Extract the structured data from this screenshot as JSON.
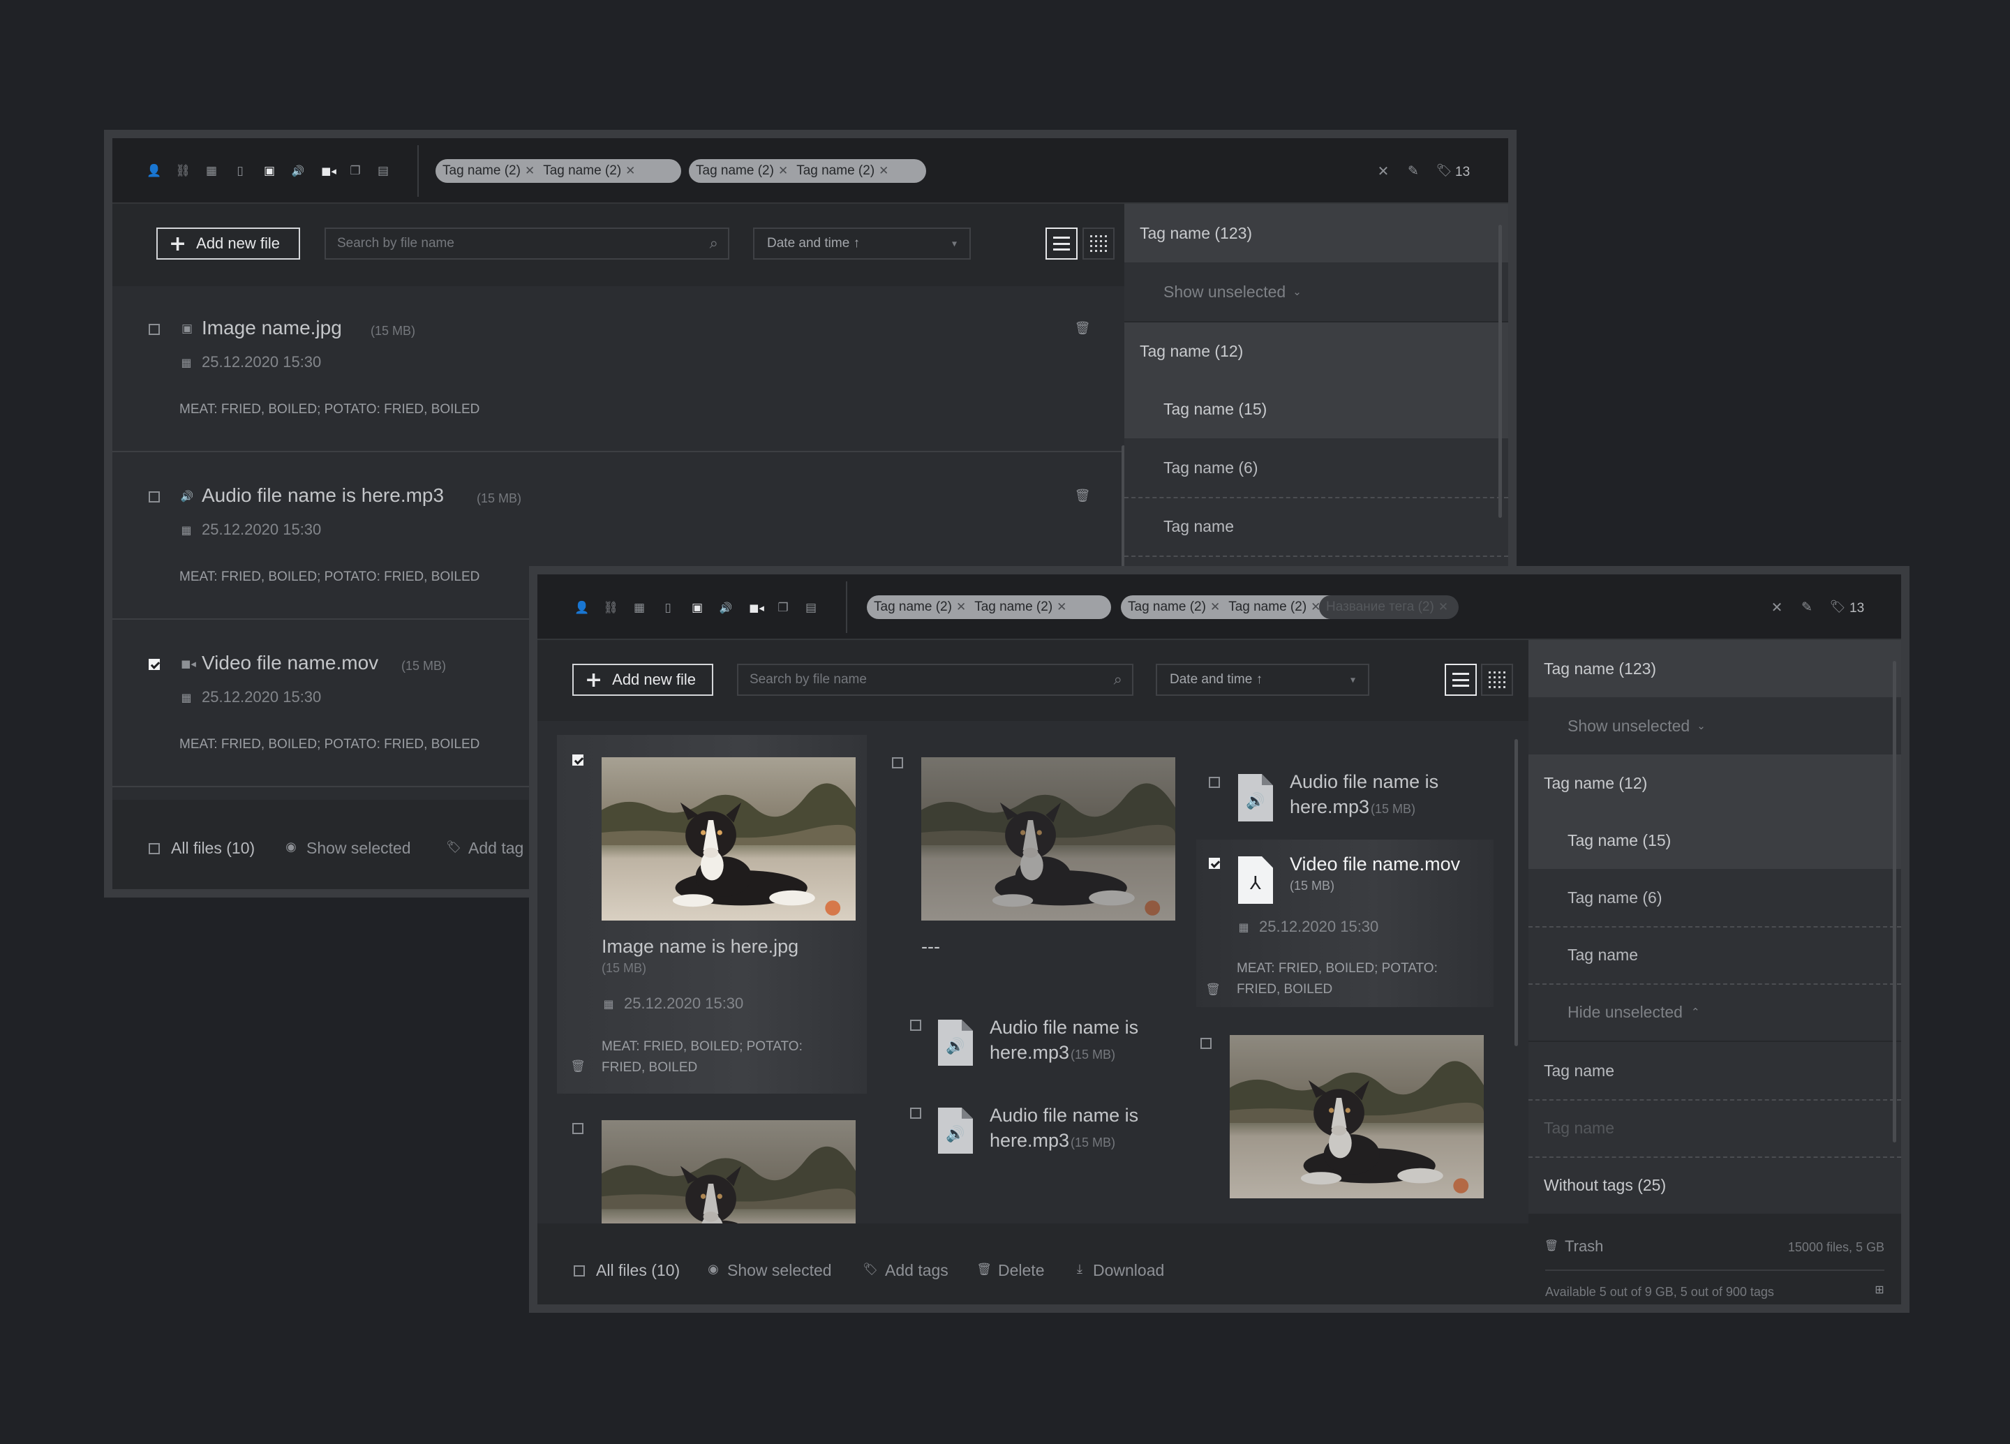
{
  "back_window": {
    "toolbar": {
      "tags_group1": [
        "Tag name (2)",
        "Tag name (2)"
      ],
      "tags_group2": [
        "Tag name (2)",
        "Tag name (2)"
      ],
      "tag_count": "13"
    },
    "actions": {
      "add_label": "Add new file",
      "search_placeholder": "Search by file name",
      "sort_label": "Date and time ↑"
    },
    "files": [
      {
        "name": "Image name.jpg",
        "size": "(15 MB)",
        "date": "25.12.2020 15:30",
        "tags": "MEAT: FRIED, BOILED; POTATO: FRIED, BOILED",
        "checked": false
      },
      {
        "name": "Audio file name is here.mp3",
        "size": "(15 MB)",
        "date": "25.12.2020 15:30",
        "tags": "MEAT: FRIED, BOILED; POTATO: FRIED, BOILED",
        "checked": false
      },
      {
        "name": "Video file name.mov",
        "size": "(15 MB)",
        "date": "25.12.2020 15:30",
        "tags": "MEAT: FRIED, BOILED; POTATO: FRIED, BOILED",
        "checked": true
      }
    ],
    "footer": {
      "all_files": "All files (10)",
      "show_selected": "Show selected",
      "add_tags": "Add tag"
    },
    "sidebar": {
      "root": "Tag name (123)",
      "show_unselected": "Show unselected",
      "group": "Tag name (12)",
      "items": [
        "Tag name (15)",
        "Tag name (6)",
        "Tag name"
      ]
    }
  },
  "front_window": {
    "toolbar": {
      "tags_group1": [
        "Tag name (2)",
        "Tag name (2)"
      ],
      "tags_group2": [
        "Tag name (2)",
        "Tag name (2)"
      ],
      "tag_faded": "Название тега (2)",
      "tag_count": "13"
    },
    "actions": {
      "add_label": "Add new file",
      "search_placeholder": "Search by file name",
      "sort_label": "Date and time ↑"
    },
    "grid": {
      "col1": {
        "name": "Image name is here.jpg",
        "size": "(15 MB)",
        "date": "25.12.2020 15:30",
        "tags_line1": "MEAT: FRIED, BOILED; POTATO:",
        "tags_line2": "FRIED, BOILED"
      },
      "col2": {
        "name": "---",
        "audio1_line1": "Audio file name is",
        "audio1_line2": "here.mp3",
        "audio1_size": "(15 MB)",
        "audio2_line1": "Audio file name is",
        "audio2_line2": "here.mp3",
        "audio2_size": "(15 MB)"
      },
      "col3": {
        "audio_line1": "Audio file name is",
        "audio_line2": "here.mp3",
        "audio_size": "(15 MB)",
        "video_name": "Video file name.mov",
        "video_size": "(15 MB)",
        "video_date": "25.12.2020 15:30",
        "video_tags_line1": "MEAT: FRIED, BOILED; POTATO:",
        "video_tags_line2": "FRIED, BOILED"
      }
    },
    "footer": {
      "all_files": "All files (10)",
      "show_selected": "Show selected",
      "add_tags": "Add tags",
      "delete": "Delete",
      "download": "Download"
    },
    "sidebar": {
      "root": "Tag name (123)",
      "show_unselected": "Show unselected",
      "group": "Tag name (12)",
      "items": [
        "Tag name (15)",
        "Tag name (6)",
        "Tag name"
      ],
      "hide_unselected": "Hide unselected",
      "tag_plain": "Tag name",
      "tag_placeholder": "Tag name",
      "without_tags": "Without tags (25)",
      "trash": "Trash",
      "trash_info": "15000 files, 5 GB",
      "available": "Available 5 out of 9 GB, 5 out of 900 tags"
    }
  },
  "colors": {
    "background": "#202226",
    "panel": "#2b2d31",
    "sidebar": "#3a3c40",
    "chip": "#9fa1a5",
    "accent_text": "#e8e9eb"
  }
}
